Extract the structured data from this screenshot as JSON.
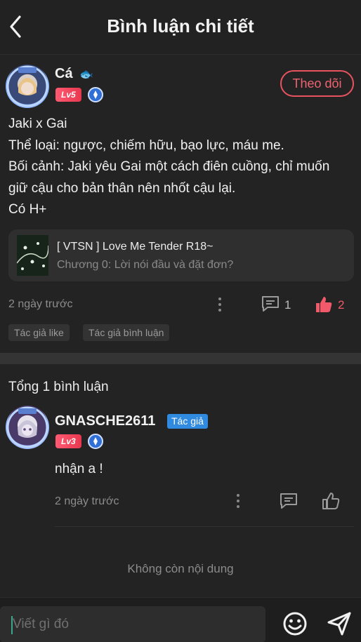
{
  "header": {
    "title": "Bình luận chi tiết",
    "back_icon": "chevron-left-icon"
  },
  "post": {
    "author": {
      "name": "Cá",
      "emoji": "🐟",
      "level": "Lv5"
    },
    "follow_label": "Theo dõi",
    "content": "Jaki x Gai\nThể loại: ngược, chiếm hữu, bạo lực, máu me.\nBối cảnh: Jaki yêu Gai một cách điên cuồng, chỉ muốn giữ cậu cho bản thân nên nhốt cậu lại.\nCó H+",
    "link": {
      "title": "[ VTSN ] Love Me Tender R18~",
      "subtitle": "Chương 0: Lời nói đầu và đặt đơn?"
    },
    "time": "2 ngày trước",
    "comment_count": "1",
    "like_count": "2",
    "tags": [
      "Tác giả like",
      "Tác giả bình luận"
    ]
  },
  "comments": {
    "total_label": "Tổng 1 bình luận",
    "items": [
      {
        "name": "GNASCHE2611",
        "author_tag": "Tác giả",
        "level": "Lv3",
        "text": "nhận a !",
        "time": "2 ngày trước"
      }
    ],
    "end_label": "Không còn nội dung"
  },
  "composer": {
    "placeholder": "Viết gì đó"
  },
  "colors": {
    "accent": "#e8535f",
    "author_tag": "#2f8ae0",
    "background": "#232323"
  }
}
